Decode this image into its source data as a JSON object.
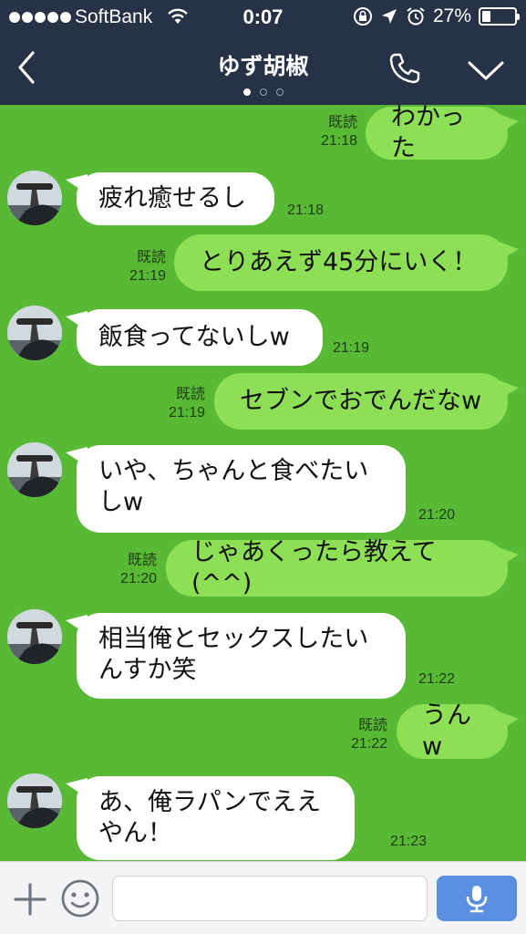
{
  "status": {
    "carrier": "SoftBank",
    "time": "0:07",
    "battery_percent": "27%",
    "battery_level": 0.27
  },
  "nav": {
    "title": "ゆず胡椒",
    "page_count": 3,
    "active_page": 1
  },
  "messages": [
    {
      "dir": "out",
      "text": "わかった",
      "read": "既読",
      "time": "21:18"
    },
    {
      "dir": "in",
      "text": "疲れ癒せるし",
      "time": "21:18"
    },
    {
      "dir": "out",
      "text": "とりあえず45分にいく！",
      "read": "既読",
      "time": "21:19"
    },
    {
      "dir": "in",
      "text": "飯食ってないしw",
      "time": "21:19"
    },
    {
      "dir": "out",
      "text": "セブンでおでんだなw",
      "read": "既読",
      "time": "21:19"
    },
    {
      "dir": "in",
      "text": "いや、ちゃんと食べたいしw",
      "time": "21:20"
    },
    {
      "dir": "out",
      "text": "じゃあくったら教えて(^^)",
      "read": "既読",
      "time": "21:20"
    },
    {
      "dir": "in",
      "text": "相当俺とセックスしたいんすか笑",
      "time": "21:22"
    },
    {
      "dir": "out",
      "text": "うんw",
      "read": "既読",
      "time": "21:22"
    },
    {
      "dir": "in",
      "text": "あ、俺ラパンでええやん！",
      "time": "21:23"
    }
  ],
  "input": {
    "placeholder": ""
  },
  "icons": {
    "back": "chevron-left-icon",
    "call": "phone-icon",
    "menu": "chevron-down-icon",
    "add": "plus-icon",
    "emoji": "smiley-icon",
    "voice": "microphone-icon"
  },
  "colors": {
    "header": "#273246",
    "chat_background": "#58b935",
    "outgoing_bubble": "#8de055",
    "incoming_bubble": "#ffffff",
    "mic_button": "#5b8fe0"
  }
}
